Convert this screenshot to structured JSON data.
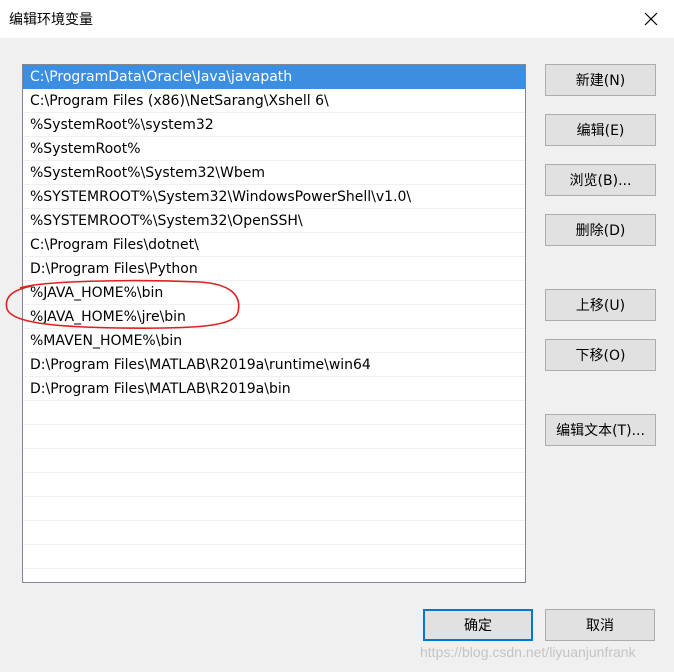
{
  "window": {
    "title": "编辑环境变量",
    "close_icon": "close-icon"
  },
  "path_list": {
    "items": [
      "C:\\ProgramData\\Oracle\\Java\\javapath",
      "C:\\Program Files (x86)\\NetSarang\\Xshell 6\\",
      "%SystemRoot%\\system32",
      "%SystemRoot%",
      "%SystemRoot%\\System32\\Wbem",
      "%SYSTEMROOT%\\System32\\WindowsPowerShell\\v1.0\\",
      "%SYSTEMROOT%\\System32\\OpenSSH\\",
      "C:\\Program Files\\dotnet\\",
      "D:\\Program Files\\Python",
      "%JAVA_HOME%\\bin",
      "%JAVA_HOME%\\jre\\bin",
      "%MAVEN_HOME%\\bin",
      "D:\\Program Files\\MATLAB\\R2019a\\runtime\\win64",
      "D:\\Program Files\\MATLAB\\R2019a\\bin",
      "",
      "",
      "",
      "",
      "",
      "",
      "",
      ""
    ],
    "selected_index": 0,
    "selection_color": "#3c8fe0"
  },
  "side_buttons": {
    "new": "新建(N)",
    "edit": "编辑(E)",
    "browse": "浏览(B)...",
    "delete": "删除(D)",
    "move_up": "上移(U)",
    "move_down": "下移(O)",
    "edit_text": "编辑文本(T)..."
  },
  "bottom_buttons": {
    "ok": "确定",
    "cancel": "取消"
  },
  "annotation": {
    "color": "#e02020"
  },
  "watermark": "https://blog.csdn.net/liyuanjunfrank"
}
